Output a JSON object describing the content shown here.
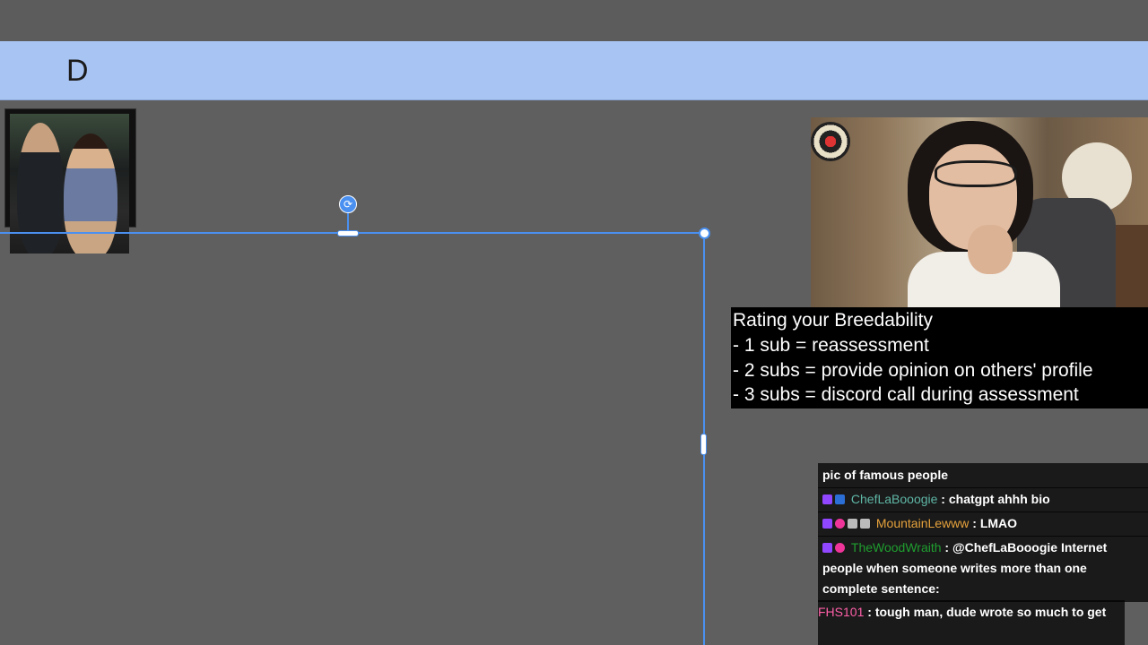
{
  "header": {
    "letter": "D"
  },
  "photo": {
    "icon": "photo-thumbnail"
  },
  "selection": {
    "rotate_glyph": "⟳"
  },
  "overlay": {
    "lines": [
      "Rating your Breedability",
      "- 1 sub = reassessment",
      "- 2 subs = provide opinion on others' profile",
      "- 3 subs = discord call during assessment"
    ]
  },
  "chat": {
    "messages": [
      {
        "user": "",
        "text": "pic of famous people",
        "color": ""
      },
      {
        "user": "ChefLaBooogie",
        "sep": " : ",
        "text": "chatgpt ahhh bio",
        "color": "#5fb7a6"
      },
      {
        "user": "MountainLewww",
        "sep": " : ",
        "text": "LMAO",
        "color": "#e6a23c"
      },
      {
        "user": "TheWoodWraith",
        "sep": " : ",
        "text": "@ChefLaBooogie Internet people when someone writes more than one complete sentence:",
        "color": "#1f9e2f"
      },
      {
        "user": "FHS101",
        "sep": " : ",
        "text": "tough man, dude wrote so much to get",
        "color": "#ff5fa8"
      }
    ]
  },
  "colors": {
    "accent": "#4a90f0",
    "header_bg": "#a8c4f3",
    "canvas_bg": "#5f5f5f"
  }
}
